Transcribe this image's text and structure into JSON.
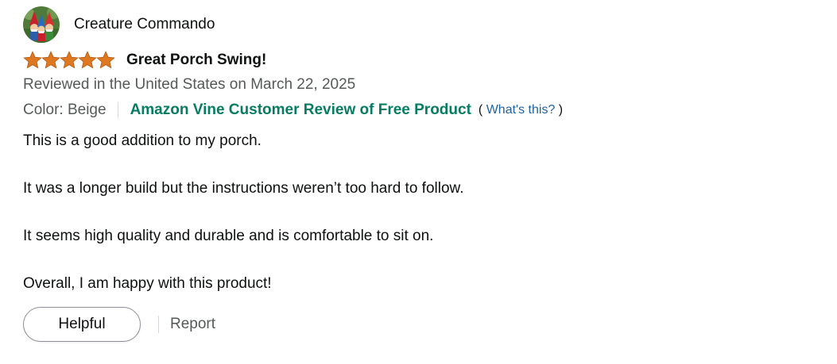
{
  "reviewer": {
    "name": "Creature Commando",
    "avatar_icon": "gnome-avatar-icon"
  },
  "rating": {
    "stars": 5,
    "max": 5,
    "color": "#de7921"
  },
  "review": {
    "title": "Great Porch Swing!",
    "date_text": "Reviewed in the United States on March 22, 2025",
    "variant": "Color: Beige",
    "vine_badge": "Amazon Vine Customer Review of Free Product",
    "help_open": "(",
    "help_link": "What's this?",
    "help_close": ")",
    "paragraphs": [
      "This is a good addition to my porch.",
      "It was a longer build but the instructions weren’t too hard to follow.",
      "It seems high quality and durable and is comfortable to sit on.",
      "Overall, I am happy with this product!"
    ]
  },
  "actions": {
    "helpful_label": "Helpful",
    "report_label": "Report"
  },
  "colors": {
    "vine_green": "#067d62",
    "link_blue": "#2162a1",
    "muted_text": "#565959"
  }
}
